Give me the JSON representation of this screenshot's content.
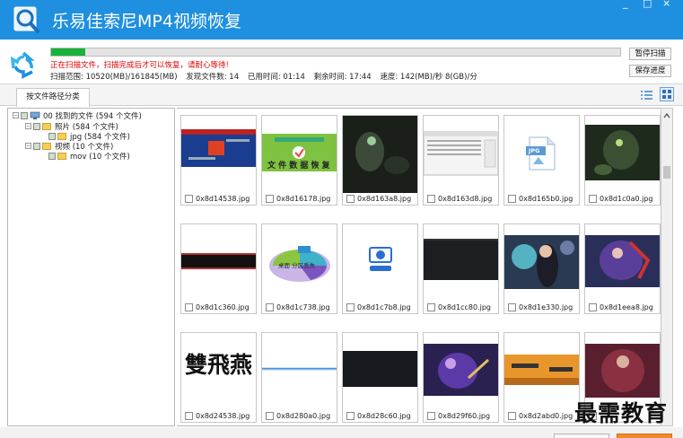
{
  "window": {
    "title": "乐易佳索尼MP4视频恢复",
    "controls": [
      "_",
      "□",
      "×"
    ]
  },
  "scan": {
    "progress_percent": 6,
    "status_message": "正在扫描文件，扫描完成后才可以恢复，请耐心等待!",
    "scan_range_label": "扫描范围: 10520(MB)/161845(MB)",
    "found_files_label": "发现文件数: 14",
    "elapsed_label": "已用时间: 01:14",
    "remaining_label": "剩余时间: 17:44",
    "speed_label": "速度: 142(MB)/秒 8(GB)/分",
    "pause_button": "暂停扫描",
    "save_progress_button": "保存进度"
  },
  "tabs": {
    "by_path": "按文件路径分类"
  },
  "tree": {
    "root": "00 找到的文件 (594 个文件)",
    "photos": "照片   (584 个文件)",
    "jpg": "jpg   (584 个文件)",
    "video": "视频   (10 个文件)",
    "mov": "mov   (10 个文件)"
  },
  "files": [
    "0x8d14538.jpg",
    "0x8d16178.jpg",
    "0x8d163a8.jpg",
    "0x8d163d8.jpg",
    "0x8d165b0.jpg",
    "0x8d1c0a0.jpg",
    "0x8d1c360.jpg",
    "0x8d1c738.jpg",
    "0x8d1c7b8.jpg",
    "0x8d1cc80.jpg",
    "0x8d1e330.jpg",
    "0x8d1eea8.jpg",
    "0x8d24538.jpg",
    "0x8d280a0.jpg",
    "0x8d28c60.jpg",
    "0x8d29f60.jpg",
    "0x8d2abd0.jpg",
    ""
  ],
  "thumb_text": {
    "cell2": "文 件 数 据 恢 复",
    "cell8": "桌面 分区丢失",
    "cell13": "雙飛燕",
    "cell5": "JPG"
  },
  "watermark": "最需教育",
  "colors": {
    "title_bar": "#1f8fe0",
    "progress": "#17b33a",
    "status_red": "#e00000"
  }
}
